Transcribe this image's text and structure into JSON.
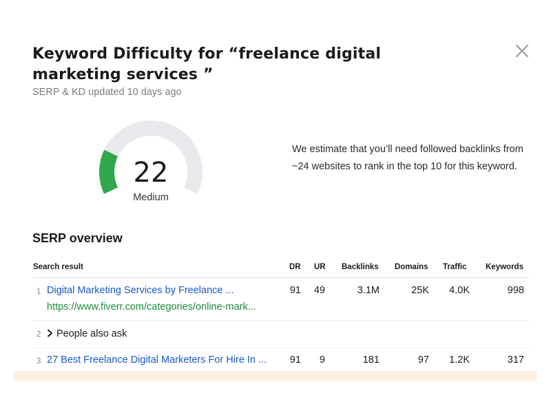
{
  "header": {
    "title": "Keyword Difficulty for “freelance digital marketing services ”",
    "subtitle": "SERP & KD updated 10 days ago"
  },
  "gauge": {
    "value": "22",
    "label": "Medium",
    "fill_fraction": 0.22,
    "track_color": "#e8e9ec",
    "fill_color": "#2ea84a"
  },
  "estimate": {
    "text": "We estimate that you’ll need followed backlinks from ~24 websites to rank in the top 10 for this keyword."
  },
  "serp": {
    "title": "SERP overview",
    "columns": {
      "search_result": "Search result",
      "dr": "DR",
      "ur": "UR",
      "backlinks": "Backlinks",
      "domains": "Domains",
      "traffic": "Traffic",
      "keywords": "Keywords"
    },
    "rows": [
      {
        "position": "1",
        "title": "Digital Marketing Services by Freelance ...",
        "url": "https://www.fiverr.com/categories/online-mark...",
        "dr": "91",
        "ur": "49",
        "backlinks": "3.1M",
        "domains": "25K",
        "traffic": "4.0K",
        "keywords": "998"
      },
      {
        "position": "2",
        "label": "People also ask"
      },
      {
        "position": "3",
        "title": "27 Best Freelance Digital Marketers For Hire In ...",
        "dr": "91",
        "ur": "9",
        "backlinks": "181",
        "domains": "97",
        "traffic": "1.2K",
        "keywords": "317"
      }
    ]
  },
  "icons": {
    "close": "close-icon",
    "expand": "chevron-right-icon"
  }
}
